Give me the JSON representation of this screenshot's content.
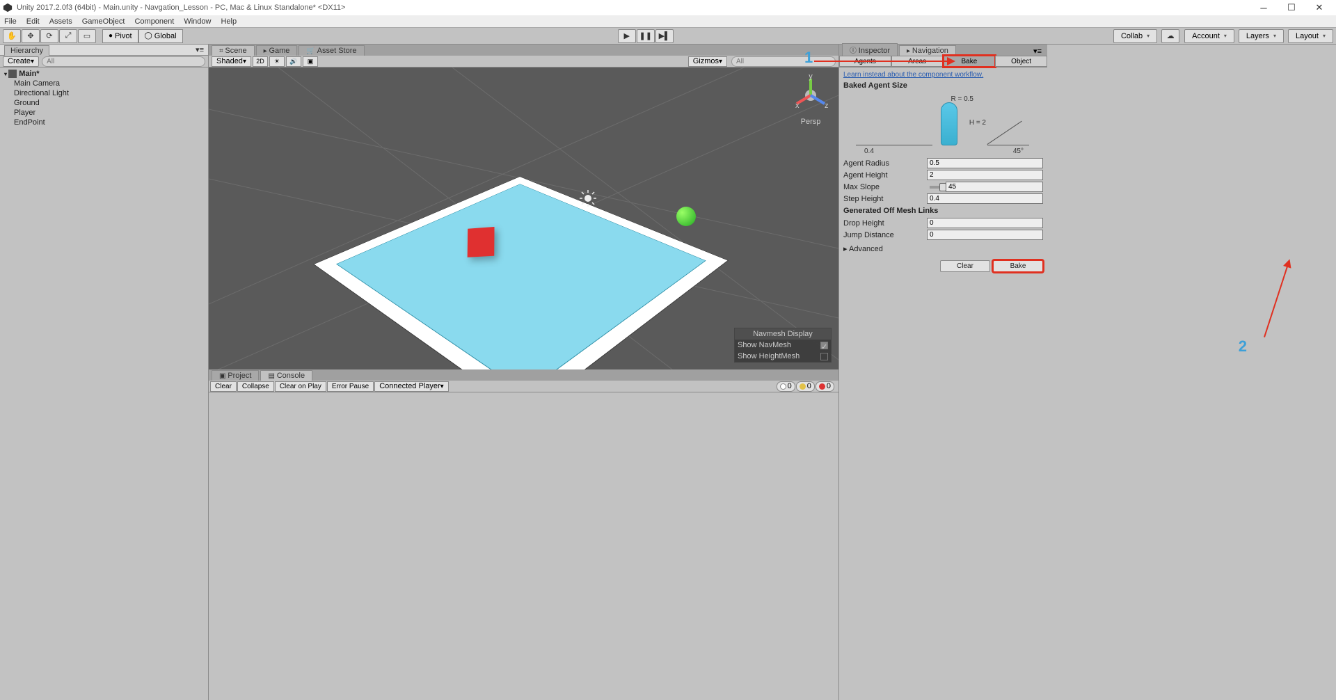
{
  "window": {
    "title": "Unity 2017.2.0f3 (64bit) - Main.unity - Navgation_Lesson - PC, Mac & Linux Standalone* <DX11>"
  },
  "menu": [
    "File",
    "Edit",
    "Assets",
    "GameObject",
    "Component",
    "Window",
    "Help"
  ],
  "toolbar": {
    "pivot": "Pivot",
    "global": "Global",
    "collab": "Collab",
    "account": "Account",
    "layers": "Layers",
    "layout": "Layout"
  },
  "hierarchy": {
    "tab": "Hierarchy",
    "create": "Create",
    "search_ph": "All",
    "root": "Main*",
    "items": [
      "Main Camera",
      "Directional Light",
      "Ground",
      "Player",
      "EndPoint"
    ]
  },
  "scene": {
    "tabs": [
      "Scene",
      "Game",
      "Asset Store"
    ],
    "shading": "Shaded",
    "mode2d": "2D",
    "gizmos": "Gizmos",
    "search_ph": "All",
    "persp": "Persp",
    "navmesh_display": "Navmesh Display",
    "show_navmesh": "Show NavMesh",
    "show_heightmesh": "Show HeightMesh"
  },
  "console": {
    "tabs": [
      "Project",
      "Console"
    ],
    "buttons": [
      "Clear",
      "Collapse",
      "Clear on Play",
      "Error Pause",
      "Connected Player"
    ],
    "counts": {
      "info": "0",
      "warn": "0",
      "err": "0"
    }
  },
  "inspector": {
    "tabs": [
      "Inspector",
      "Navigation"
    ],
    "subtabs": [
      "Agents",
      "Areas",
      "Bake",
      "Object"
    ],
    "workflow": "Learn instead about the component workflow.",
    "baked_size_h": "Baked Agent Size",
    "viz": {
      "r": "R = 0.5",
      "h": "H = 2",
      "step": "0.4",
      "slope": "45°"
    },
    "agent_radius_l": "Agent Radius",
    "agent_radius_v": "0.5",
    "agent_height_l": "Agent Height",
    "agent_height_v": "2",
    "max_slope_l": "Max Slope",
    "max_slope_v": "45",
    "step_height_l": "Step Height",
    "step_height_v": "0.4",
    "offmesh_h": "Generated Off Mesh Links",
    "drop_height_l": "Drop Height",
    "drop_height_v": "0",
    "jump_dist_l": "Jump Distance",
    "jump_dist_v": "0",
    "advanced": "Advanced",
    "clear": "Clear",
    "bake": "Bake"
  },
  "annotations": {
    "n1": "1",
    "n2": "2"
  }
}
